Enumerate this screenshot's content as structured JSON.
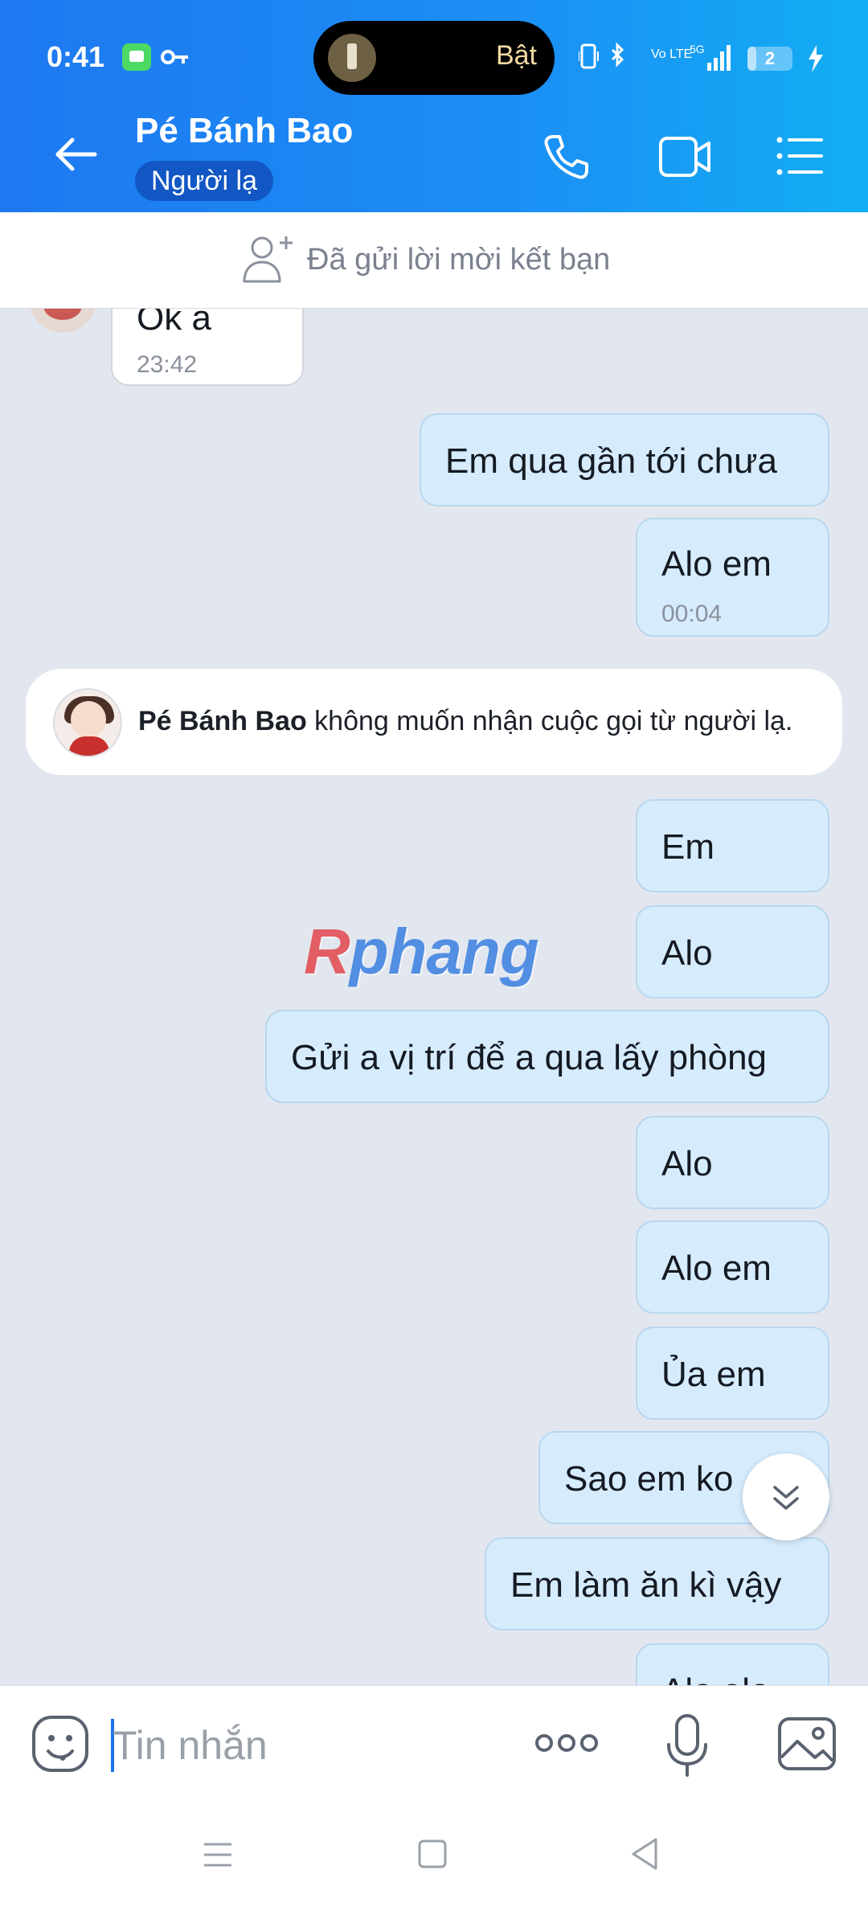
{
  "status_bar": {
    "time": "0:41",
    "flashlight_label": "Bật",
    "battery_level": "2",
    "battery_fraction": 0.2,
    "signal_label": "5G",
    "volte_label": "Vo LTE"
  },
  "header": {
    "contact_name": "Pé Bánh Bao",
    "stranger_badge": "Người lạ"
  },
  "friend_request": {
    "text": "Đã gửi lời mời kết bạn"
  },
  "messages": [
    {
      "direction": "in",
      "text": "Ok a",
      "time": "23:42"
    },
    {
      "direction": "out",
      "text": "Em qua gần tới chưa",
      "time": ""
    },
    {
      "direction": "out",
      "text": "Alo em",
      "time": "00:04"
    },
    {
      "direction": "out",
      "text": "Em",
      "time": ""
    },
    {
      "direction": "out",
      "text": "Alo",
      "time": ""
    },
    {
      "direction": "out",
      "text": "Gửi a vị trí để a qua lấy phòng",
      "time": ""
    },
    {
      "direction": "out",
      "text": "Alo",
      "time": ""
    },
    {
      "direction": "out",
      "text": "Alo em",
      "time": ""
    },
    {
      "direction": "out",
      "text": "Ủa em",
      "time": ""
    },
    {
      "direction": "out",
      "text": "Sao em ko ...",
      "time": ""
    },
    {
      "direction": "out",
      "text": "Em làm ăn kì vậy",
      "time": ""
    },
    {
      "direction": "out",
      "text": "Alo alo",
      "time": ""
    }
  ],
  "system_notice": {
    "name": "Pé Bánh Bao",
    "text": "không muốn nhận cuộc gọi từ người lạ."
  },
  "watermark": {
    "first_letter": "R",
    "rest": "phang"
  },
  "input_bar": {
    "placeholder": "Tin nhắn"
  },
  "icons": {
    "back": "back-arrow-icon",
    "call": "phone-icon",
    "video": "video-camera-icon",
    "menu": "list-menu-icon",
    "add_friend": "add-friend-icon",
    "scroll_down": "double-chevron-down-icon",
    "emoji": "emoji-icon",
    "more": "more-dots-icon",
    "mic": "microphone-icon",
    "image": "image-icon"
  },
  "colors": {
    "header_start": "#1e78f0",
    "header_end": "#12aef3",
    "outgoing_bubble": "#d6ecfd",
    "incoming_bubble": "#ffffff",
    "chat_background": "#e2e7ef",
    "badge": "#1257c4"
  }
}
